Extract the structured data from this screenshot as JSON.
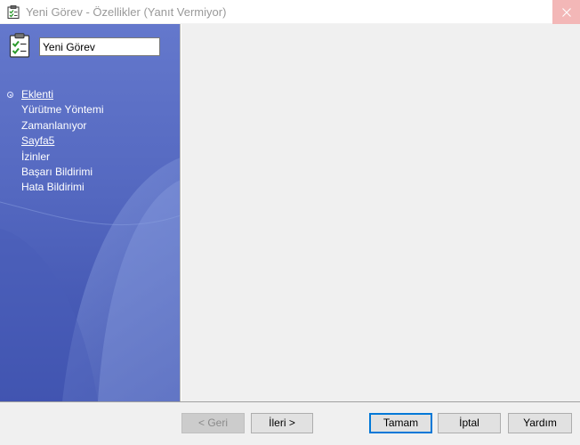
{
  "window": {
    "title": "Yeni Görev - Özellikler (Yanıt Vermiyor)",
    "close_glyph": "✕"
  },
  "task": {
    "name_value": "Yeni Görev"
  },
  "nav": {
    "items": [
      {
        "label": "Eklenti"
      },
      {
        "label": "Yürütme Yöntemi"
      },
      {
        "label": "Zamanlanıyor"
      },
      {
        "label": "Sayfa5"
      },
      {
        "label": "İzinler"
      },
      {
        "label": "Başarı Bildirimi"
      },
      {
        "label": "Hata Bildirimi"
      }
    ]
  },
  "buttons": {
    "back": "< Geri",
    "next": "İleri >",
    "ok": "Tamam",
    "cancel": "İptal",
    "help": "Yardım"
  },
  "colors": {
    "sidebar_top": "#5a70c6",
    "sidebar_bottom": "#3c4fab",
    "content_bg": "#f0f0f0",
    "default_button_border": "#0078d7",
    "close_button_bg": "#f3b7b7"
  }
}
